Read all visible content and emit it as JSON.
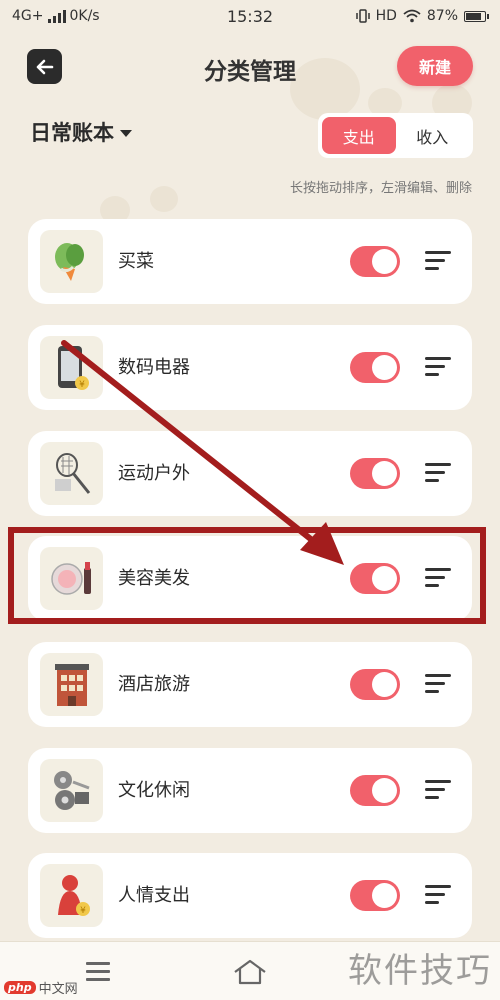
{
  "status_bar": {
    "network": "4G+",
    "speed": "0K/s",
    "time": "15:32",
    "hd": "HD",
    "battery": "87%"
  },
  "header": {
    "title": "分类管理",
    "new_label": "新建",
    "back_icon": "back-arrow-icon"
  },
  "book": {
    "name": "日常账本"
  },
  "segment": {
    "expense": "支出",
    "income": "收入",
    "selected": "支出"
  },
  "hint": "长按拖动排序，左滑编辑、删除",
  "categories": [
    {
      "label": "买菜",
      "icon": "vegetable-icon",
      "enabled": true
    },
    {
      "label": "数码电器",
      "icon": "phone-icon",
      "enabled": true
    },
    {
      "label": "运动户外",
      "icon": "racket-icon",
      "enabled": true
    },
    {
      "label": "美容美发",
      "icon": "makeup-icon",
      "enabled": true
    },
    {
      "label": "酒店旅游",
      "icon": "hotel-icon",
      "enabled": true
    },
    {
      "label": "文化休闲",
      "icon": "film-reel-icon",
      "enabled": true
    },
    {
      "label": "人情支出",
      "icon": "person-coin-icon",
      "enabled": true
    }
  ],
  "colors": {
    "accent": "#f1616b",
    "background": "#f2ece1",
    "annotation": "#a31d1d"
  },
  "watermark": {
    "site": "软件技巧",
    "badge": "php",
    "brand": "中文网"
  }
}
